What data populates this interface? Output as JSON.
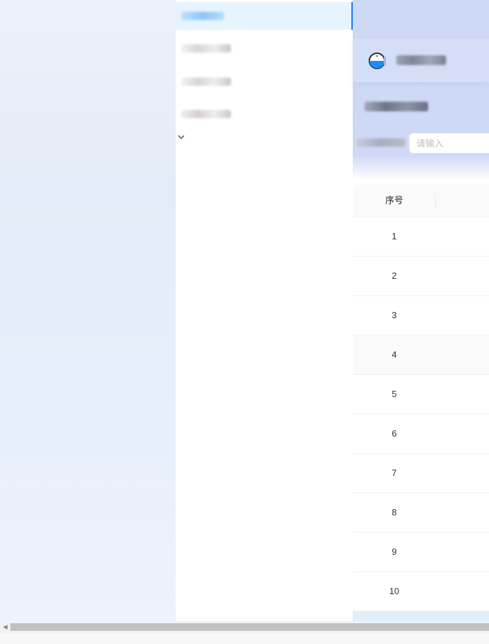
{
  "colors": {
    "accent": "#1677ff",
    "menu_active_bg": "#e6f4ff",
    "header_bg": "#cdd8f5"
  },
  "menu": {
    "items": [
      {
        "label": "",
        "active": true
      },
      {
        "label": "",
        "active": false
      },
      {
        "label": "",
        "active": false
      },
      {
        "label": "",
        "active": false
      }
    ],
    "expand_icon": "chevron-down-icon"
  },
  "header": {
    "logo_icon": "half-circle-logo-icon",
    "title": "",
    "subtitle": ""
  },
  "search": {
    "label": "",
    "placeholder": "请输入",
    "value": ""
  },
  "table": {
    "columns": [
      "序号"
    ],
    "rows": [
      "1",
      "2",
      "3",
      "4",
      "5",
      "6",
      "7",
      "8",
      "9",
      "10"
    ],
    "hover_row": 3
  },
  "scrollbar": {
    "left_arrow_icon": "scroll-left-arrow-icon"
  }
}
